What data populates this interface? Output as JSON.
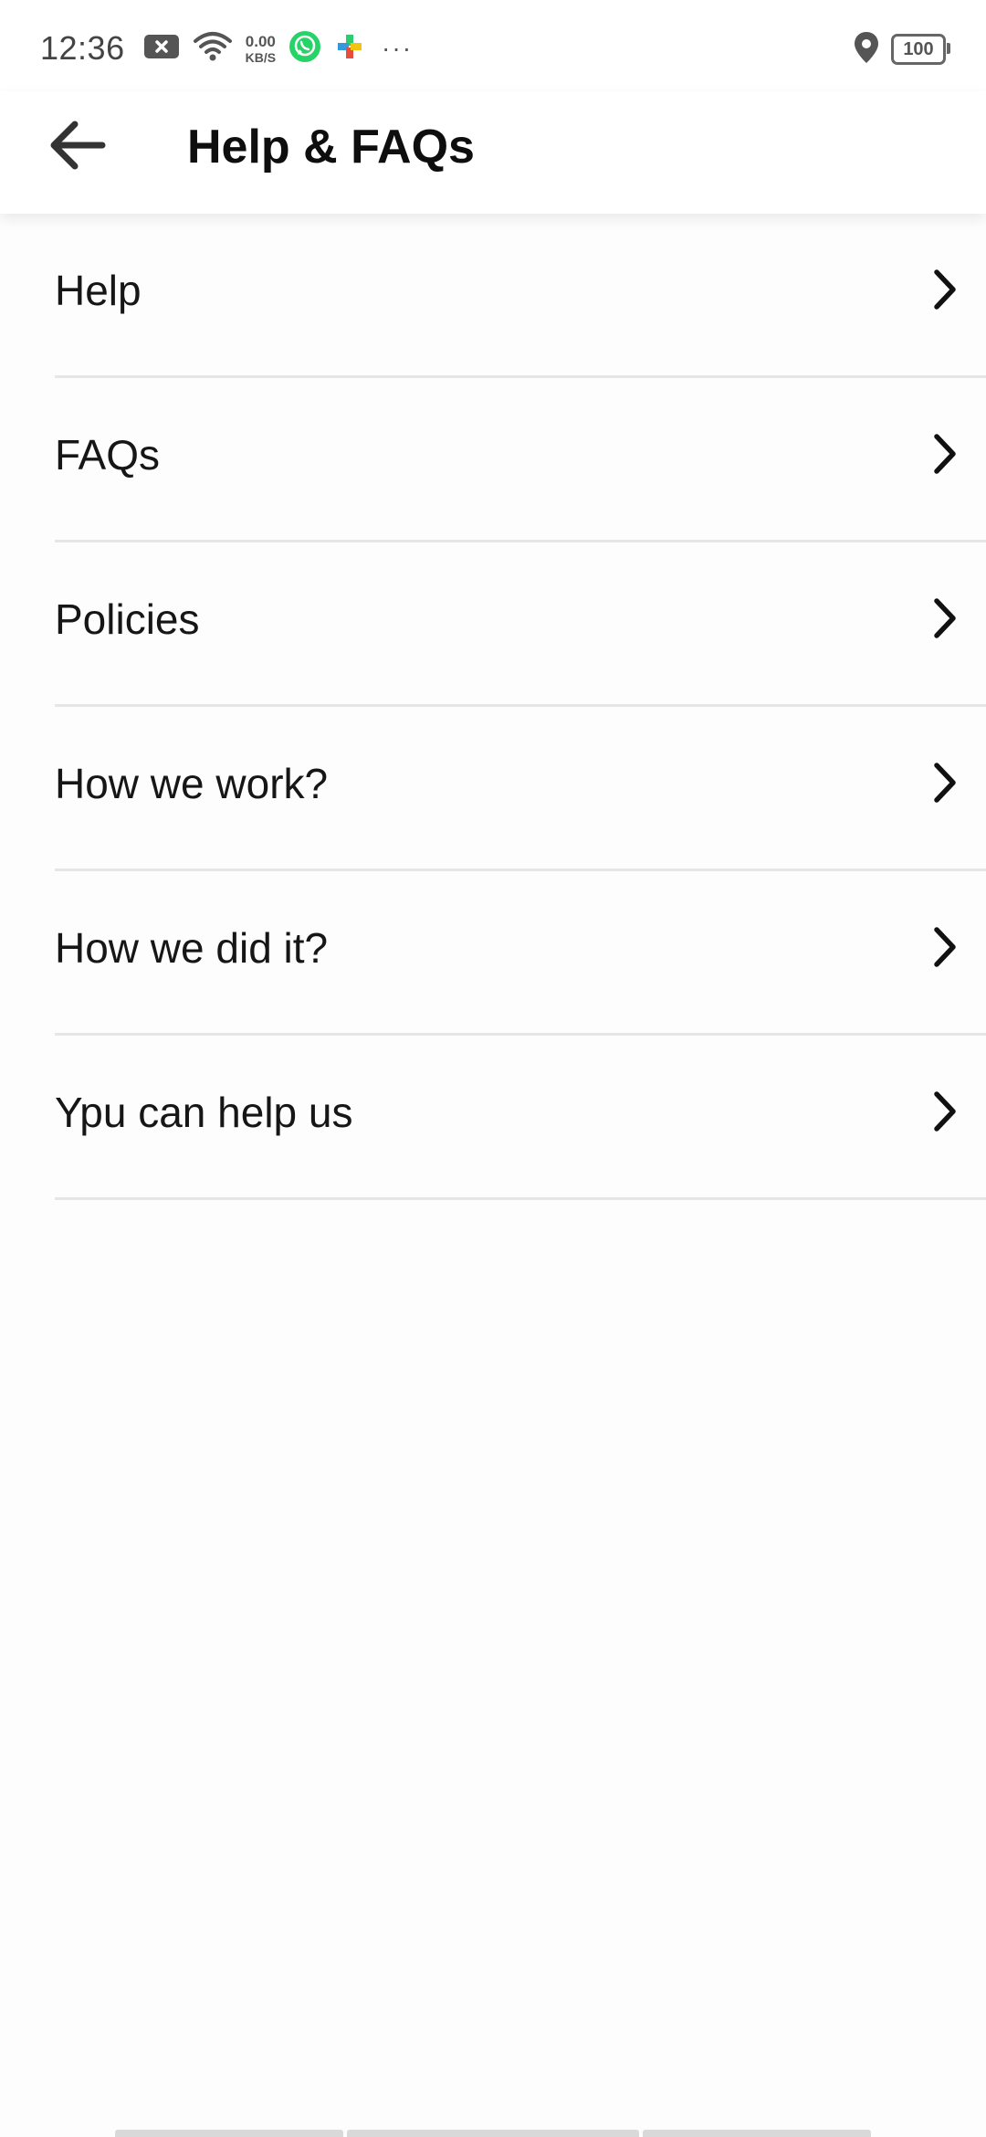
{
  "status_bar": {
    "time": "12:36",
    "net_speed_value": "0.00",
    "net_speed_unit": "KB/S",
    "more": "···",
    "battery": "100"
  },
  "header": {
    "title": "Help & FAQs"
  },
  "menu": {
    "items": [
      {
        "label": "Help"
      },
      {
        "label": "FAQs"
      },
      {
        "label": "Policies"
      },
      {
        "label": "How we work?"
      },
      {
        "label": "How we did it?"
      },
      {
        "label": "Ypu can help us"
      }
    ]
  },
  "icons": {
    "back": "arrow-left-icon",
    "chevron": "chevron-right-icon"
  },
  "colors": {
    "whatsapp": "#25D366",
    "text": "#161616",
    "divider": "#e6e6e6"
  }
}
